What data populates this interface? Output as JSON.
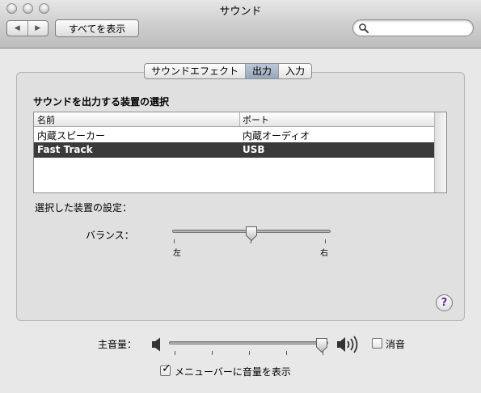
{
  "window": {
    "title": "サウンド"
  },
  "toolbar": {
    "back_glyph": "◀",
    "forward_glyph": "▶",
    "show_all_label": "すべてを表示",
    "search": {
      "placeholder": "",
      "value": ""
    }
  },
  "tabs": [
    {
      "label": "サウンドエフェクト",
      "selected": false
    },
    {
      "label": "出力",
      "selected": true
    },
    {
      "label": "入力",
      "selected": false
    }
  ],
  "output": {
    "section_title": "サウンドを出力する装置の選択",
    "columns": [
      "名前",
      "ポート"
    ],
    "rows": [
      {
        "name": "内蔵スピーカー",
        "port": "内蔵オーディオ",
        "selected": false
      },
      {
        "name": "Fast Track",
        "port": "USB",
        "selected": true
      }
    ],
    "device_settings_label": "選択した装置の設定：",
    "balance": {
      "label": "バランス：",
      "left_label": "左",
      "right_label": "右",
      "value": 0.5
    }
  },
  "volume": {
    "label": "主音量：",
    "value": 1.0,
    "mute_label": "消音",
    "muted": false,
    "show_in_menubar_label": "メニューバーに音量を表示",
    "show_in_menubar": true
  },
  "help_glyph": "?",
  "icons": [
    "back-icon",
    "forward-icon",
    "search-icon",
    "speaker-low-icon",
    "speaker-high-icon",
    "help-icon"
  ],
  "colors": {
    "selected_row_bg": "#3a3a3a",
    "selected_tab_bg": "#a8b5c8",
    "help_glyph": "#5a2d9c"
  }
}
